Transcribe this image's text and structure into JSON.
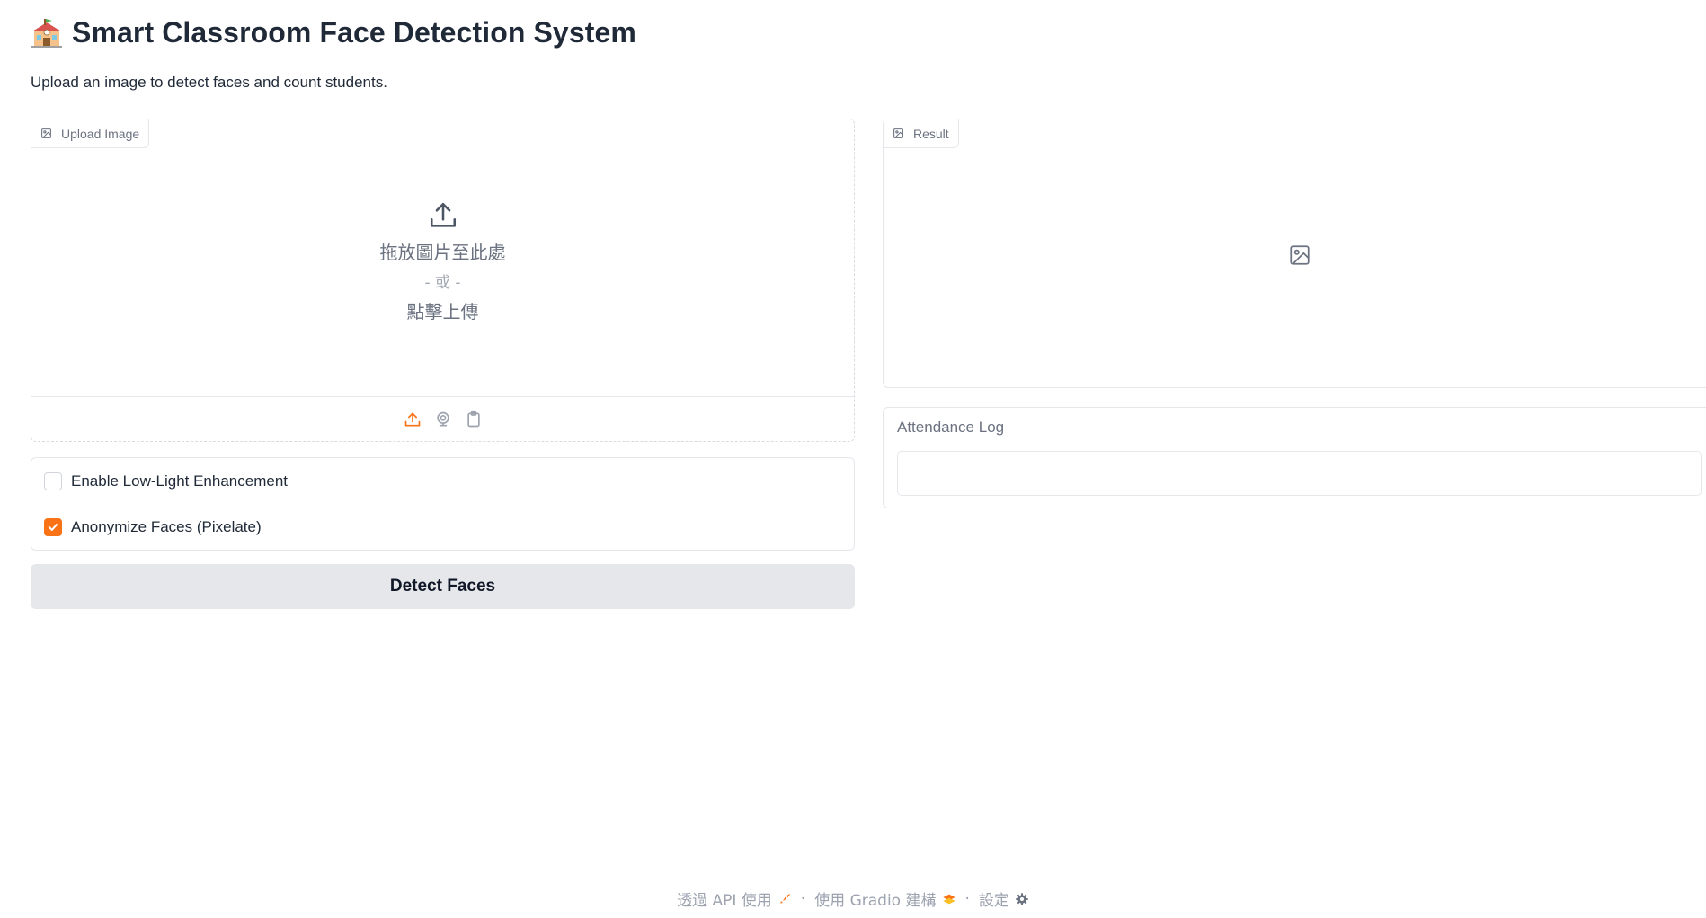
{
  "header": {
    "title": "Smart Classroom Face Detection System",
    "title_icon": "school-emoji",
    "subtitle": "Upload an image to detect faces and count students."
  },
  "upload": {
    "label": "Upload Image",
    "drop_text": "拖放圖片至此處",
    "or_text": "- 或 -",
    "click_text": "點擊上傳",
    "sources": [
      "upload-icon",
      "webcam-icon",
      "clipboard-icon"
    ],
    "active_source_color": "#f97316"
  },
  "options": {
    "low_light": {
      "label": "Enable Low-Light Enhancement",
      "checked": false
    },
    "anonymize": {
      "label": "Anonymize Faces (Pixelate)",
      "checked": true
    }
  },
  "actions": {
    "detect_label": "Detect Faces"
  },
  "result": {
    "label": "Result"
  },
  "attendance": {
    "label": "Attendance Log",
    "value": ""
  },
  "footer": {
    "api_text": "透過 API 使用",
    "separator": "·",
    "built_text": "使用 Gradio 建構",
    "settings_text": "設定"
  },
  "colors": {
    "accent": "#f97316",
    "button_bg": "#e5e7eb",
    "border": "#e5e7eb",
    "muted_text": "#6b7280"
  }
}
